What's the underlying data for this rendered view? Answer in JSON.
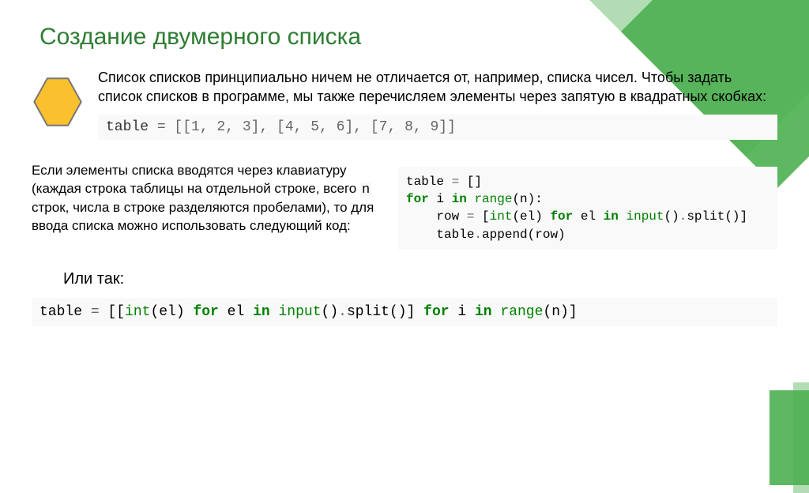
{
  "title": "Создание двумерного списка",
  "para1": "Список списков принципиально ничем не отличается от, например, списка чисел. Чтобы задать список списков в программе, мы также перечисляем элементы через запятую в квадратных скобках:",
  "code1_lhs": "table ",
  "code1_eq": "= ",
  "code1_rhs": "[[1, 2, 3], [4, 5, 6], [7, 8, 9]]",
  "para2_a": "Если элементы списка вводятся через клавиатуру (каждая строка таблицы на отдельной строке, всего ",
  "para2_n": "n",
  "para2_b": " строк, числа в строке разделяются пробелами), то для ввода списка можно использовать следующий код:",
  "code2": {
    "l1_a": "table ",
    "l1_eq": "=",
    "l1_b": " []",
    "l2_for": "for",
    "l2_a": " i ",
    "l2_in": "in",
    "l2_b": " ",
    "l2_range": "range",
    "l2_c": "(n):",
    "l3_a": "    row ",
    "l3_eq": "=",
    "l3_b": " [",
    "l3_int": "int",
    "l3_c": "(el) ",
    "l3_for": "for",
    "l3_d": " el ",
    "l3_in": "in",
    "l3_e": " ",
    "l3_input": "input",
    "l3_f": "()",
    "l3_dot": ".",
    "l3_split": "split",
    "l3_g": "()]",
    "l4_a": "    table",
    "l4_dot": ".",
    "l4_append": "append",
    "l4_b": "(row)"
  },
  "or_label": "Или так:",
  "code3": {
    "a": "table ",
    "eq": "=",
    "b": " [[",
    "int": "int",
    "c": "(el) ",
    "for1": "for",
    "d": " el ",
    "in1": "in",
    "e": " ",
    "input": "input",
    "f": "()",
    "dot": ".",
    "split": "split",
    "g": "()] ",
    "for2": "for",
    "h": " i ",
    "in2": "in",
    "i": " ",
    "range": "range",
    "j": "(n)]"
  }
}
